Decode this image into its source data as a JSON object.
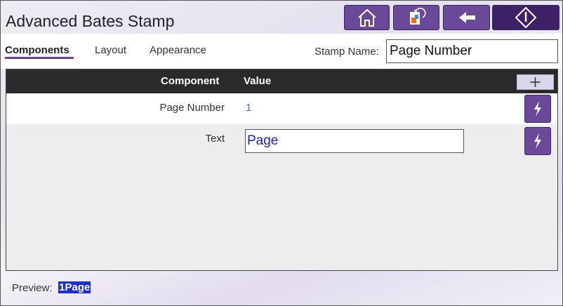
{
  "header": {
    "title": "Advanced Bates Stamp"
  },
  "toolbar": {
    "home_icon": "home-icon",
    "reset_icon": "reset-icon",
    "back_icon": "back-arrow-icon",
    "start_icon": "start-icon"
  },
  "tabs": [
    {
      "label": "Components",
      "active": true
    },
    {
      "label": "Layout",
      "active": false
    },
    {
      "label": "Appearance",
      "active": false
    }
  ],
  "stamp": {
    "label": "Stamp Name:",
    "value": "Page Number"
  },
  "grid": {
    "columns": {
      "component": "Component",
      "value": "Value"
    },
    "add_icon": "plus-icon",
    "rows": [
      {
        "component": "Page Number",
        "value": "1"
      },
      {
        "component": "Text",
        "value": "Page"
      }
    ]
  },
  "preview": {
    "label": "Preview:",
    "value": "1Page"
  },
  "colors": {
    "accent": "#6a4a98",
    "accent_dark": "#3c2166",
    "header": "#2a2a2a",
    "preview_bg": "#1a2ed0"
  }
}
